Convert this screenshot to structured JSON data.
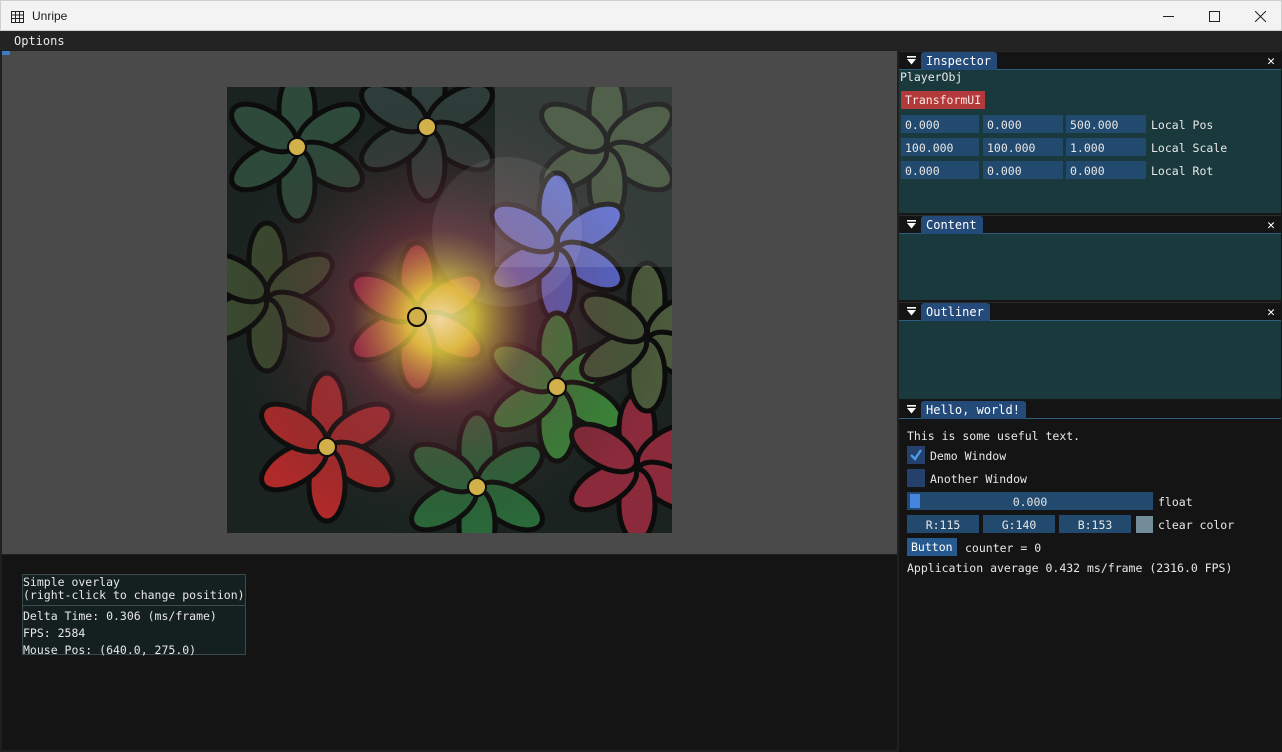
{
  "window": {
    "title": "Unripe",
    "minimize": "—",
    "maximize": "☐",
    "close": "✕"
  },
  "menu": {
    "options": "Options"
  },
  "overlay": {
    "line1": "Simple overlay",
    "line2": "(right-click to change position)",
    "delta": "Delta Time: 0.306 (ms/frame)",
    "fps": "FPS: 2584",
    "mouse": "Mouse Pos: (640.0, 275.0)"
  },
  "inspector": {
    "tab": "Inspector",
    "object_name": "PlayerObj",
    "component_button": "TransformUI",
    "rows": [
      {
        "values": [
          "0.000",
          "0.000",
          "500.000"
        ],
        "label": "Local Pos"
      },
      {
        "values": [
          "100.000",
          "100.000",
          "1.000"
        ],
        "label": "Local Scale"
      },
      {
        "values": [
          "0.000",
          "0.000",
          "0.000"
        ],
        "label": "Local Rot"
      }
    ]
  },
  "content": {
    "tab": "Content"
  },
  "outliner": {
    "tab": "Outliner"
  },
  "hello": {
    "tab": "Hello, world!",
    "text": "This is some useful text.",
    "demo_window": {
      "label": "Demo Window",
      "checked": true
    },
    "another_window": {
      "label": "Another Window",
      "checked": false
    },
    "float_slider": {
      "value": "0.000",
      "label": "float"
    },
    "clear_color": {
      "r": "R:115",
      "g": "G:140",
      "b": "B:153",
      "label": "clear color",
      "swatch": "#738c99"
    },
    "button": "Button",
    "counter": "counter = 0",
    "app_avg": "Application average 0.432 ms/frame (2316.0 FPS)"
  },
  "colors": {
    "accent": "#244a7a",
    "panel_bg": "#19393d",
    "danger": "#b33a3a"
  }
}
